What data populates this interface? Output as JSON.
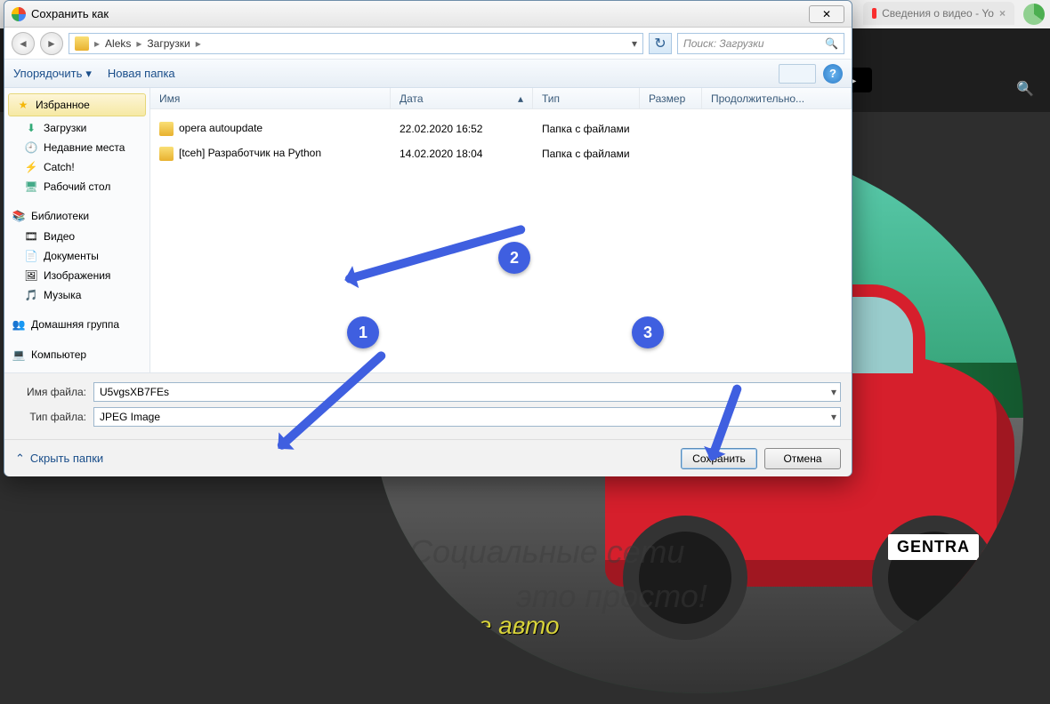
{
  "browser": {
    "tabs": [
      {
        "label": "Сведения о видео - Yo",
        "icon_color": "#ff0000"
      }
    ]
  },
  "background": {
    "plate": "GENTRA",
    "overlay1": "Социальные сети",
    "overlay2": "это просто!",
    "caption": "В мире авто"
  },
  "dialog": {
    "title": "Сохранить как",
    "breadcrumbs": [
      "Aleks",
      "Загрузки"
    ],
    "search_placeholder": "Поиск: Загрузки",
    "toolbar": {
      "organize": "Упорядочить",
      "new_folder": "Новая папка"
    },
    "sidebar": {
      "favorites": "Избранное",
      "fav_items": [
        "Загрузки",
        "Недавние места",
        "Catch!",
        "Рабочий стол"
      ],
      "libraries": "Библиотеки",
      "lib_items": [
        "Видео",
        "Документы",
        "Изображения",
        "Музыка"
      ],
      "homegroup": "Домашняя группа",
      "computer": "Компьютер"
    },
    "columns": {
      "name": "Имя",
      "date": "Дата",
      "type": "Тип",
      "size": "Размер",
      "duration": "Продолжительно..."
    },
    "rows": [
      {
        "name": "opera autoupdate",
        "date": "22.02.2020 16:52",
        "type": "Папка с файлами"
      },
      {
        "name": "[tceh] Разработчик на Python",
        "date": "14.02.2020 18:04",
        "type": "Папка с файлами"
      }
    ],
    "form": {
      "filename_label": "Имя файла:",
      "filename_value": "U5vgsXB7FEs",
      "filetype_label": "Тип файла:",
      "filetype_value": "JPEG Image"
    },
    "footer": {
      "hide_folders": "Скрыть папки",
      "save": "Сохранить",
      "cancel": "Отмена"
    }
  },
  "annotations": {
    "a1": "1",
    "a2": "2",
    "a3": "3"
  }
}
